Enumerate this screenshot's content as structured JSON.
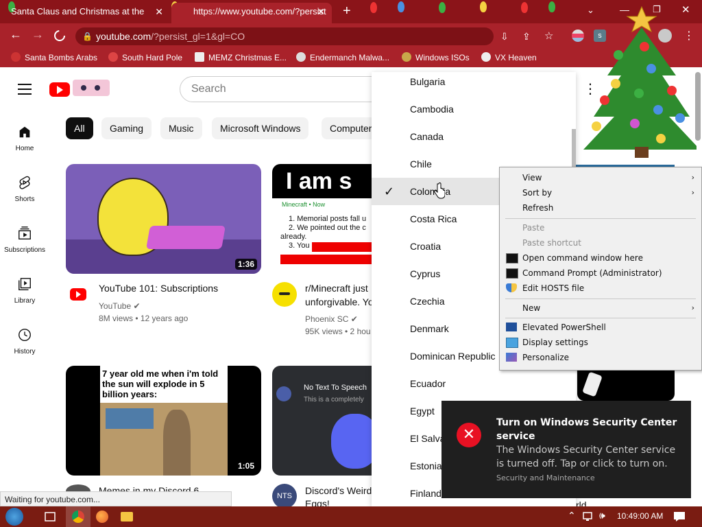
{
  "browser": {
    "tabs": [
      {
        "title": "Santa Claus and Christmas at the"
      },
      {
        "title": "https://www.youtube.com/?persist"
      }
    ],
    "address": {
      "host": "youtube.com",
      "path": "/?persist_gl=1&gl=CO"
    },
    "bookmarks": [
      {
        "label": "Santa Bombs Arabs"
      },
      {
        "label": "South Hard Pole"
      },
      {
        "label": "MEMZ Christmas E..."
      },
      {
        "label": "Endermanch Malwa..."
      },
      {
        "label": "Windows ISOs"
      },
      {
        "label": "VX Heaven"
      }
    ],
    "status_text": "Waiting for youtube.com..."
  },
  "youtube": {
    "search_placeholder": "Search",
    "chips": [
      "All",
      "Gaming",
      "Music",
      "Microsoft Windows",
      "Computer"
    ],
    "nav": [
      "Home",
      "Shorts",
      "Subscriptions",
      "Library",
      "History"
    ],
    "videos": [
      {
        "title": "YouTube 101: Subscriptions",
        "channel": "YouTube",
        "meta": "8M views • 12 years ago",
        "duration": "1:36"
      },
      {
        "title": "r/Minecraft just",
        "title2": "unforgivable. Yo",
        "channel": "Phoenix SC",
        "meta": "95K views • 2 hou",
        "thumb_text": "I am s",
        "thumb_lines": [
          "1. Memorial posts fall u",
          "2. We pointed out the c",
          "already.",
          "3. You"
        ],
        "thumb_sub": "Minecraft • Now"
      },
      {
        "title": "Memes in my Discord 6",
        "thumb_text": "7 year old me when i'm told the sun will explode in 5 billion years:",
        "duration": "1:05"
      },
      {
        "title": "Discord's Weird",
        "title2": "Eggs!",
        "thumb_text": "No Text To Speech",
        "thumb_sub": "This is a completely"
      }
    ],
    "partial_right_title": "rld"
  },
  "country_menu": {
    "items": [
      "Bulgaria",
      "Cambodia",
      "Canada",
      "Chile",
      "Colombia",
      "Costa Rica",
      "Croatia",
      "Cyprus",
      "Czechia",
      "Denmark",
      "Dominican Republic",
      "Ecuador",
      "Egypt",
      "El Salva",
      "Estonia",
      "Finland"
    ],
    "selected": "Colombia"
  },
  "context_menu": {
    "items": [
      {
        "label": "View",
        "arrow": "›",
        "disabled": false
      },
      {
        "label": "Sort by",
        "arrow": "›",
        "disabled": false
      },
      {
        "label": "Refresh",
        "disabled": false
      },
      {
        "label": "Paste",
        "disabled": true
      },
      {
        "label": "Paste shortcut",
        "disabled": true
      },
      {
        "label": "Open command window here",
        "icon": "cmd-icon",
        "disabled": false
      },
      {
        "label": "Command Prompt (Administrator)",
        "icon": "cmd-icon",
        "disabled": false
      },
      {
        "label": "Edit HOSTS file",
        "icon": "shield-icon",
        "disabled": false
      },
      {
        "label": "New",
        "arrow": "›",
        "disabled": false
      },
      {
        "label": "Elevated PowerShell",
        "icon": "powershell-icon",
        "disabled": false
      },
      {
        "label": "Display settings",
        "icon": "display-icon",
        "disabled": false
      },
      {
        "label": "Personalize",
        "icon": "personalize-icon",
        "disabled": false
      }
    ]
  },
  "toast": {
    "title": "Turn on Windows Security Center service",
    "body": "The Windows Security Center service is turned off. Tap or click to turn on.",
    "source": "Security and Maintenance"
  },
  "taskbar": {
    "time": "10:49:00 AM"
  },
  "colors": {
    "chrome_red": "#a9222a",
    "yt_red": "#ff0000",
    "error_red": "#e81123",
    "toast_bg": "#1f1f1f"
  }
}
